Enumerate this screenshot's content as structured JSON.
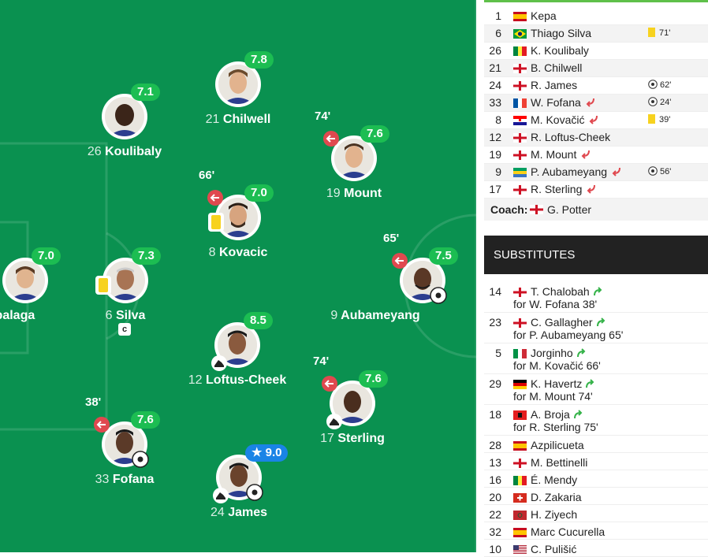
{
  "colors": {
    "pitch": "#0a9150",
    "rating": "#1cbd52",
    "star_rating": "#1a84e6",
    "sub_off": "#e0494f",
    "sub_on": "#36b34a",
    "yellow_card": "#f7d21f"
  },
  "pitch_players": [
    {
      "id": "kepa",
      "number": "",
      "name": "rrizabalaga",
      "rating": "7.0"
    },
    {
      "id": "koulibaly",
      "number": "26",
      "name": "Koulibaly",
      "rating": "7.1"
    },
    {
      "id": "silva",
      "number": "6",
      "name": "Silva",
      "rating": "7.3",
      "captain": "c"
    },
    {
      "id": "fofana",
      "number": "33",
      "name": "Fofana",
      "rating": "7.6",
      "sub_time": "38'"
    },
    {
      "id": "chilwell",
      "number": "21",
      "name": "Chilwell",
      "rating": "7.8"
    },
    {
      "id": "kovacic",
      "number": "8",
      "name": "Kovacic",
      "rating": "7.0",
      "sub_time": "66'"
    },
    {
      "id": "loftus",
      "number": "12",
      "name": "Loftus-Cheek",
      "rating": "8.5"
    },
    {
      "id": "james",
      "number": "24",
      "name": "James",
      "rating": "9.0"
    },
    {
      "id": "mount",
      "number": "19",
      "name": "Mount",
      "rating": "7.6",
      "sub_time": "74'"
    },
    {
      "id": "sterling",
      "number": "17",
      "name": "Sterling",
      "rating": "7.6",
      "sub_time": "74'"
    },
    {
      "id": "aubameyang",
      "number": "9",
      "name": "Aubameyang",
      "rating": "7.5",
      "sub_time": "65'"
    }
  ],
  "lineup": [
    {
      "number": "1",
      "flag": "spain",
      "name": "Kepa",
      "event": ""
    },
    {
      "number": "6",
      "flag": "brazil",
      "name": "Thiago Silva",
      "event": "71'",
      "event_type": "yellow-card"
    },
    {
      "number": "26",
      "flag": "senegal",
      "name": "K. Koulibaly",
      "event": ""
    },
    {
      "number": "21",
      "flag": "england",
      "name": "B. Chilwell",
      "event": ""
    },
    {
      "number": "24",
      "flag": "england",
      "name": "R. James",
      "event": "62'",
      "event_type": "goal"
    },
    {
      "number": "33",
      "flag": "france",
      "name": "W. Fofana",
      "event": "24'",
      "event_type": "goal",
      "subbed": true
    },
    {
      "number": "8",
      "flag": "croatia",
      "name": "M. Kovačić",
      "event": "39'",
      "event_type": "yellow-card",
      "subbed": true
    },
    {
      "number": "12",
      "flag": "england",
      "name": "R. Loftus-Cheek",
      "event": ""
    },
    {
      "number": "19",
      "flag": "england",
      "name": "M. Mount",
      "event": "",
      "subbed": true
    },
    {
      "number": "9",
      "flag": "gabon",
      "name": "P. Aubameyang",
      "event": "56'",
      "event_type": "goal",
      "subbed": true
    },
    {
      "number": "17",
      "flag": "england",
      "name": "R. Sterling",
      "event": "",
      "subbed": true
    }
  ],
  "coach": {
    "label": "Coach:",
    "flag": "england",
    "name": "G. Potter"
  },
  "substitutes_title": "SUBSTITUTES",
  "substitutes": [
    {
      "number": "14",
      "flag": "england",
      "name": "T. Chalobah",
      "for": "for W. Fofana 38'"
    },
    {
      "number": "23",
      "flag": "england",
      "name": "C. Gallagher",
      "for": "for P. Aubameyang 65'"
    },
    {
      "number": "5",
      "flag": "italy",
      "name": "Jorginho",
      "for": "for M. Kovačić 66'"
    },
    {
      "number": "29",
      "flag": "germany",
      "name": "K. Havertz",
      "for": "for M. Mount 74'"
    },
    {
      "number": "18",
      "flag": "albania",
      "name": "A. Broja",
      "for": "for R. Sterling 75'"
    },
    {
      "number": "28",
      "flag": "spain",
      "name": "Azpilicueta",
      "for": ""
    },
    {
      "number": "13",
      "flag": "england",
      "name": "M. Bettinelli",
      "for": ""
    },
    {
      "number": "16",
      "flag": "senegal",
      "name": "É. Mendy",
      "for": ""
    },
    {
      "number": "20",
      "flag": "switzerland",
      "name": "D. Zakaria",
      "for": ""
    },
    {
      "number": "22",
      "flag": "morocco",
      "name": "H. Ziyech",
      "for": ""
    },
    {
      "number": "32",
      "flag": "spain",
      "name": "Marc Cucurella",
      "for": ""
    },
    {
      "number": "10",
      "flag": "usa",
      "name": "C. Pulišić",
      "for": ""
    }
  ]
}
